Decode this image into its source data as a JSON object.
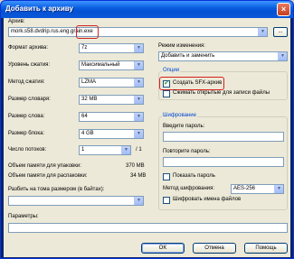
{
  "window": {
    "title": "Добавить к архиву",
    "close_glyph": "×"
  },
  "archive": {
    "label": "Архив:",
    "path": "mork.s58.dvdrip.rus.eng.grain",
    "ext": ".exe",
    "browse_label": "..."
  },
  "left": {
    "format_label": "Формат архива:",
    "format_value": "7z",
    "level_label": "Уровень сжатия:",
    "level_value": "Максимальный",
    "method_label": "Метод сжатия:",
    "method_value": "LZMA",
    "dict_label": "Размер словаря:",
    "dict_value": "32 MB",
    "word_label": "Размер слова:",
    "word_value": "64",
    "block_label": "Размер блока:",
    "block_value": "4 GB",
    "threads_label": "Число потоков:",
    "threads_value": "1",
    "threads_max": "/ 1",
    "mem_pack_label": "Объем памяти для упаковки:",
    "mem_pack_value": "370 MB",
    "mem_unpack_label": "Объем памяти для распаковки:",
    "mem_unpack_value": "34 MB",
    "split_label": "Разбить на тома размером (в байтах):",
    "split_value": "",
    "params_label": "Параметры:",
    "params_value": ""
  },
  "right": {
    "update_mode_label": "Режим изменения:",
    "update_mode_value": "Добавить и заменить",
    "options_group": "Опции",
    "sfx_label": "Создать SFX-архив",
    "sfx_checked": true,
    "shared_label": "Сжимать открытые для записи файлы",
    "shared_checked": false,
    "enc_group": "Шифрование",
    "pwd_label": "Введите пароль:",
    "pwd_value": "",
    "pwd2_label": "Повторите пароль:",
    "pwd2_value": "",
    "show_pwd_label": "Показать пароль",
    "show_pwd_checked": false,
    "enc_method_label": "Метод шифрования:",
    "enc_method_value": "AES-256",
    "enc_names_label": "Шифровать имена файлов",
    "enc_names_checked": false
  },
  "buttons": {
    "ok": "OK",
    "cancel": "Отмена",
    "help": "Помощь"
  },
  "icons": {
    "dropdown": "▼",
    "check": "✔"
  },
  "colors": {
    "highlight": "#d42020",
    "group_title": "#0046d5"
  }
}
